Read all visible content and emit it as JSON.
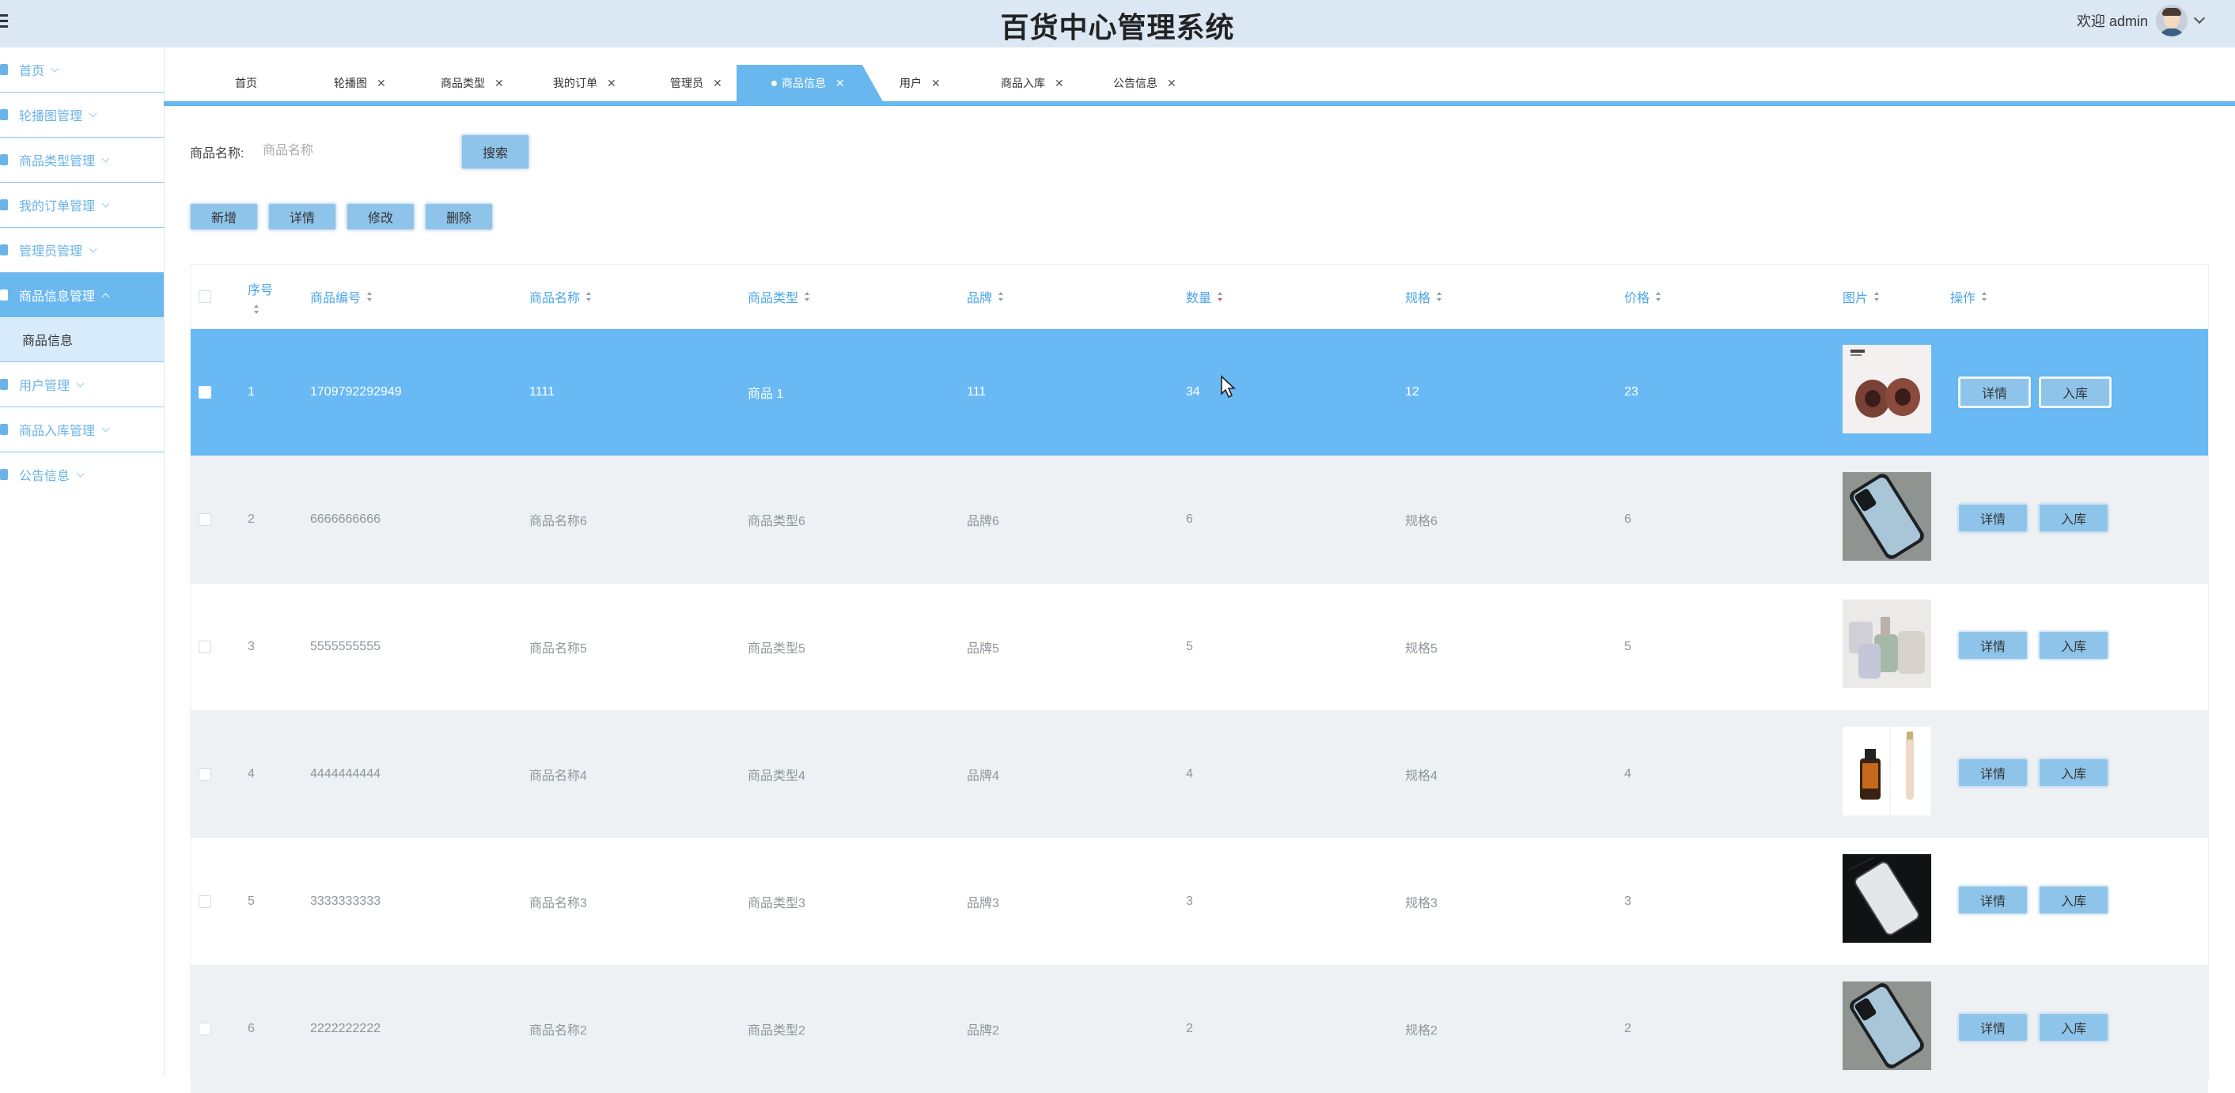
{
  "header": {
    "title": "百货中心管理系统",
    "welcome": "欢迎 admin"
  },
  "sidebar": {
    "items": [
      {
        "label": "首页",
        "icon": "home-icon"
      },
      {
        "label": "轮播图管理",
        "icon": "picture-icon"
      },
      {
        "label": "商品类型管理",
        "icon": "category-icon"
      },
      {
        "label": "我的订单管理",
        "icon": "order-icon"
      },
      {
        "label": "管理员管理",
        "icon": "admin-icon"
      },
      {
        "label": "商品信息管理",
        "icon": "goods-icon",
        "active": true
      },
      {
        "label": "用户管理",
        "icon": "user-icon"
      },
      {
        "label": "商品入库管理",
        "icon": "stock-icon"
      },
      {
        "label": "公告信息",
        "icon": "notice-icon"
      }
    ],
    "sub_item": "商品信息"
  },
  "tabs": [
    {
      "label": "首页",
      "closable": false
    },
    {
      "label": "轮播图",
      "closable": true
    },
    {
      "label": "商品类型",
      "closable": true
    },
    {
      "label": "我的订单",
      "closable": true
    },
    {
      "label": "管理员",
      "closable": true
    },
    {
      "label": "商品信息",
      "closable": true,
      "active": true
    },
    {
      "label": "用户",
      "closable": true
    },
    {
      "label": "商品入库",
      "closable": true
    },
    {
      "label": "公告信息",
      "closable": true
    }
  ],
  "search": {
    "label": "商品名称:",
    "placeholder": "商品名称",
    "button": "搜索"
  },
  "toolbar": {
    "add": "新增",
    "detail": "详情",
    "edit": "修改",
    "delete": "删除"
  },
  "table": {
    "headers": {
      "index": "序号",
      "code": "商品编号",
      "name": "商品名称",
      "type": "商品类型",
      "brand": "品牌",
      "qty": "数量",
      "spec": "规格",
      "price": "价格",
      "image": "图片",
      "action": "操作"
    },
    "rows": [
      {
        "index": "1",
        "code": "1709792292949",
        "name": "1111",
        "type": "商品 1",
        "brand": "111",
        "qty": "34",
        "spec": "12",
        "price": "23",
        "image": "brown-rings"
      },
      {
        "index": "2",
        "code": "6666666666",
        "name": "商品名称6",
        "type": "商品类型6",
        "brand": "品牌6",
        "qty": "6",
        "spec": "规格6",
        "price": "6",
        "image": "phone-case"
      },
      {
        "index": "3",
        "code": "5555555555",
        "name": "商品名称5",
        "type": "商品类型5",
        "brand": "品牌5",
        "qty": "5",
        "spec": "规格5",
        "price": "5",
        "image": "cups"
      },
      {
        "index": "4",
        "code": "4444444444",
        "name": "商品名称4",
        "type": "商品类型4",
        "brand": "品牌4",
        "qty": "4",
        "spec": "规格4",
        "price": "4",
        "image": "cosmetics"
      },
      {
        "index": "5",
        "code": "3333333333",
        "name": "商品名称3",
        "type": "商品类型3",
        "brand": "品牌3",
        "qty": "3",
        "spec": "规格3",
        "price": "3",
        "image": "dark-phone"
      },
      {
        "index": "6",
        "code": "2222222222",
        "name": "商品名称2",
        "type": "商品类型2",
        "brand": "品牌2",
        "qty": "2",
        "spec": "规格2",
        "price": "2",
        "image": "phone-case"
      }
    ],
    "row_actions": {
      "detail": "详情",
      "stock_in": "入库"
    }
  },
  "colors": {
    "accent": "#68b7ef",
    "button": "#8fc4ea",
    "header_bg": "#dbe7f3",
    "selected_row": "#69b9f5",
    "stripe": "#eef1f4"
  }
}
